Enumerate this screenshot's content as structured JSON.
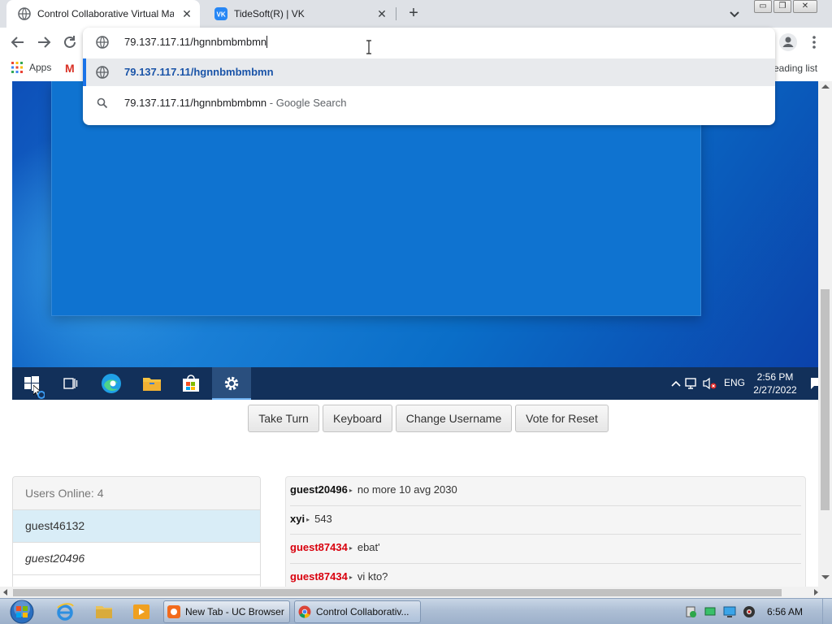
{
  "browser": {
    "tabs": [
      {
        "title": "Control Collaborative Virtual Ma"
      },
      {
        "title": "TideSoft(R) | VK"
      }
    ],
    "address": {
      "typed": "79.137.117.11/hgnnbmbmbmn"
    },
    "suggestions": [
      {
        "text": "79.137.117.11/hgnnbmbmbmn"
      },
      {
        "text": "79.137.117.11/hgnnbmbmbmn",
        "suffix": " - Google Search"
      }
    ],
    "bookmarks": {
      "apps": "Apps",
      "reading_list": "eading list"
    },
    "window_controls": {
      "minimize": "▭",
      "maximize": "❐",
      "close": "✕"
    },
    "new_tab_label": "+",
    "tab_close": "✕"
  },
  "vm": {
    "taskbar": {
      "language": "ENG",
      "time": "2:56 PM",
      "date": "2/27/2022"
    }
  },
  "controls": {
    "take_turn": "Take Turn",
    "keyboard": "Keyboard",
    "change_username": "Change Username",
    "vote_reset": "Vote for Reset"
  },
  "users": {
    "header": "Users Online: 4",
    "list": [
      {
        "name": "guest46132"
      },
      {
        "name": "guest20496"
      }
    ]
  },
  "chat": {
    "messages": [
      {
        "user": "guest20496",
        "text": "no more 10 avg 2030"
      },
      {
        "user": "xyi",
        "text": "543"
      },
      {
        "user": "guest87434",
        "text": "ebat'"
      },
      {
        "user": "guest87434",
        "text": "vi kto?"
      }
    ]
  },
  "host_taskbar": {
    "tasks": [
      {
        "label": "New Tab - UC Browser"
      },
      {
        "label": "Control Collaborativ..."
      }
    ],
    "time": "6:56 AM"
  },
  "colors": {
    "accent": "#1a73e8",
    "chat_user_red": "#d9000d",
    "user_highlight": "#d9edf7",
    "vm_taskbar": "#12305a"
  }
}
